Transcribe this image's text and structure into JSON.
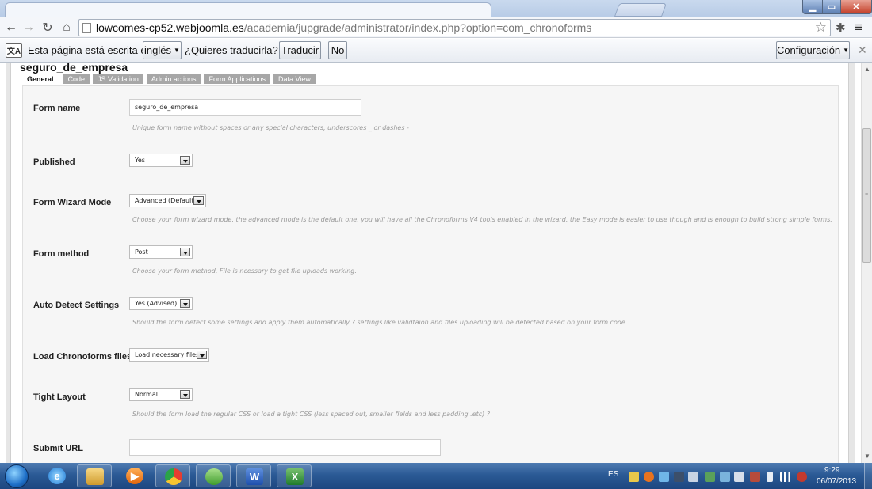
{
  "browser": {
    "url_host": "lowcomes-cp52.webjoomla.es",
    "url_path": "/academia/jupgrade/administrator/index.php?option=com_chronoforms"
  },
  "translate_bar": {
    "text_before": "Esta página está escrita en",
    "language": "inglés",
    "question": "¿Quieres traducirla?",
    "translate_label": "Traducir",
    "no_label": "No",
    "config_label": "Configuración"
  },
  "page": {
    "form_title": "seguro_de_empresa",
    "tabs": [
      "General",
      "Code",
      "JS Validation",
      "Admin actions",
      "Form Applications",
      "Data View"
    ],
    "fields": {
      "form_name": {
        "label": "Form name",
        "value": "seguro_de_empresa",
        "help": "Unique form name without spaces or any special characters, underscores _ or dashes -"
      },
      "published": {
        "label": "Published",
        "value": "Yes"
      },
      "wizard_mode": {
        "label": "Form Wizard Mode",
        "value": "Advanced (Default)",
        "help": "Choose your form wizard mode, the advanced mode is the default one, you will have all the Chronoforms V4 tools enabled in the wizard, the Easy mode is easier to use though and is enough to build strong simple forms."
      },
      "form_method": {
        "label": "Form method",
        "value": "Post",
        "help": "Choose your form method, File is ncessary to get file uploads working."
      },
      "auto_detect": {
        "label": "Auto Detect Settings",
        "value": "Yes (Advised)",
        "help": "Should the form detect some settings and apply them automatically ? settings like validtaion and files uploading will be detected based on your form code."
      },
      "load_files": {
        "label": "Load Chronoforms files",
        "value": "Load necessary files"
      },
      "tight_layout": {
        "label": "Tight Layout",
        "value": "Normal",
        "help": "Should the form load the regular CSS or load a tight CSS (less spaced out, smaller fields and less padding..etc) ?"
      },
      "submit_url": {
        "label": "Submit URL",
        "value": ""
      }
    }
  },
  "taskbar": {
    "lang": "ES",
    "time": "9:29",
    "date": "06/07/2013"
  },
  "colors": {
    "tab_inactive": "#a7a7a7",
    "panel_bg": "#f6f6f6",
    "taskbar": "#2b5a95"
  }
}
